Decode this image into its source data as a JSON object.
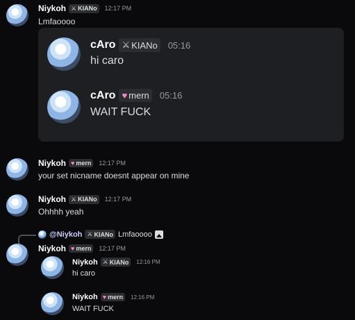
{
  "colors": {
    "background": "#0a0a0d",
    "embed_bg": "#1e1f22",
    "tag_bg": "#2b2d31",
    "heart": "#f58dc8",
    "timestamp": "#949ba4"
  },
  "icons": {
    "sword": "⚔",
    "heart": "♥",
    "image": "image-icon"
  },
  "messages": [
    {
      "author": "Niykoh",
      "tag": "KIANo",
      "time": "12:17 PM",
      "text": "Lmfaoooo"
    },
    {
      "author": "Niykoh",
      "tag": "mern",
      "time": "12:17 PM",
      "text": "your set nicname doesnt appear on mine"
    },
    {
      "author": "Niykoh",
      "tag": "KIANo",
      "time": "12:17 PM",
      "text": "Ohhhh yeah"
    },
    {
      "author": "Niykoh",
      "tag": "mern",
      "time": "12:17 PM",
      "text": ""
    }
  ],
  "embed": [
    {
      "author": "cAro",
      "tag": "KIANo",
      "time": "05:16",
      "text": "hi caro"
    },
    {
      "author": "cAro",
      "tag": "mern",
      "time": "05:16",
      "text": "WAIT FUCK"
    }
  ],
  "reply": {
    "mention": "@Niykoh",
    "tag": "KIANo",
    "text": "Lmfaoooo"
  },
  "nested": [
    {
      "author": "Niykoh",
      "tag": "KIANo",
      "time": "12:16 PM",
      "text": "hi caro"
    },
    {
      "author": "Niykoh",
      "tag": "mern",
      "time": "12:16 PM",
      "text": "WAIT FUCK"
    }
  ]
}
